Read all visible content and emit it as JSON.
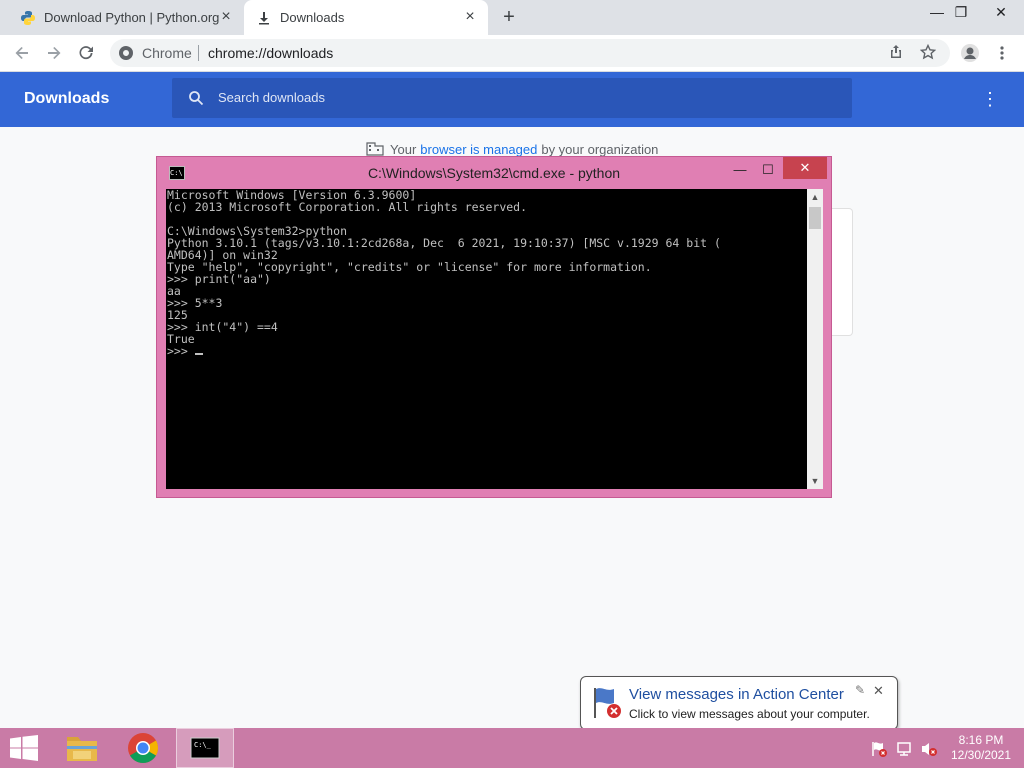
{
  "browser": {
    "tabs": [
      {
        "label": "Download Python | Python.org",
        "icon": "python-logo-icon"
      },
      {
        "label": "Downloads",
        "icon": "download-icon",
        "active": true
      }
    ],
    "omnibox": {
      "chip": "Chrome",
      "url": "chrome://downloads"
    }
  },
  "downloads": {
    "title": "Downloads",
    "search_placeholder": "Search downloads",
    "managed": {
      "pre": "Your",
      "link": "browser is managed",
      "post": "by your organization"
    }
  },
  "cmd": {
    "title": "C:\\Windows\\System32\\cmd.exe - python",
    "lines": [
      "Microsoft Windows [Version 6.3.9600]",
      "(c) 2013 Microsoft Corporation. All rights reserved.",
      "",
      "C:\\Windows\\System32>python",
      "Python 3.10.1 (tags/v3.10.1:2cd268a, Dec  6 2021, 19:10:37) [MSC v.1929 64 bit (",
      "AMD64)] on win32",
      "Type \"help\", \"copyright\", \"credits\" or \"license\" for more information.",
      ">>> print(\"aa\")",
      "aa",
      ">>> 5**3",
      "125",
      ">>> int(\"4\") ==4",
      "True"
    ],
    "prompt": ">>> "
  },
  "notification": {
    "title": "View messages in Action Center",
    "text": "Click to view messages about your computer."
  },
  "taskbar": {
    "time": "8:16 PM",
    "date": "12/30/2021",
    "accent": "#c97ba6"
  },
  "colors": {
    "chrome_blue": "#3367d6",
    "cmd_frame": "#e07fb3"
  }
}
